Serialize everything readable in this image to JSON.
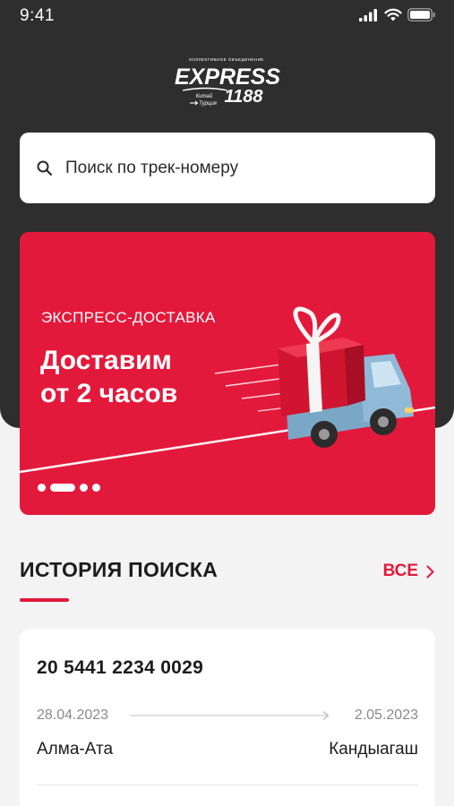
{
  "status_bar": {
    "time": "9:41"
  },
  "logo": {
    "tagline": "КОЛЛЕКТИВНОЕ ОБЪЕДИНЕНИЕ",
    "brand": "EXPRESS",
    "number": "1188",
    "route_from": "Китай",
    "route_to": "Турция"
  },
  "search": {
    "placeholder": "Поиск по трек-номеру"
  },
  "banner": {
    "kicker": "ЭКСПРЕСС-ДОСТАВКА",
    "title_line1": "Доставим",
    "title_line2": "от 2 часов",
    "slide_count": 4,
    "active_slide": 2
  },
  "history": {
    "title": "ИСТОРИЯ ПОИСКА",
    "see_all": "ВСЕ",
    "items": [
      {
        "track_number": "20 5441 2234 0029",
        "date_from": "28.04.2023",
        "date_to": "2.05.2023",
        "city_from": "Алма-Ата",
        "city_to": "Кандыагаш"
      }
    ]
  },
  "colors": {
    "accent": "#e3193b",
    "header_bg": "#2e2e2e",
    "page_bg": "#f3f3f3",
    "truck_blue": "#8fb9d6"
  }
}
